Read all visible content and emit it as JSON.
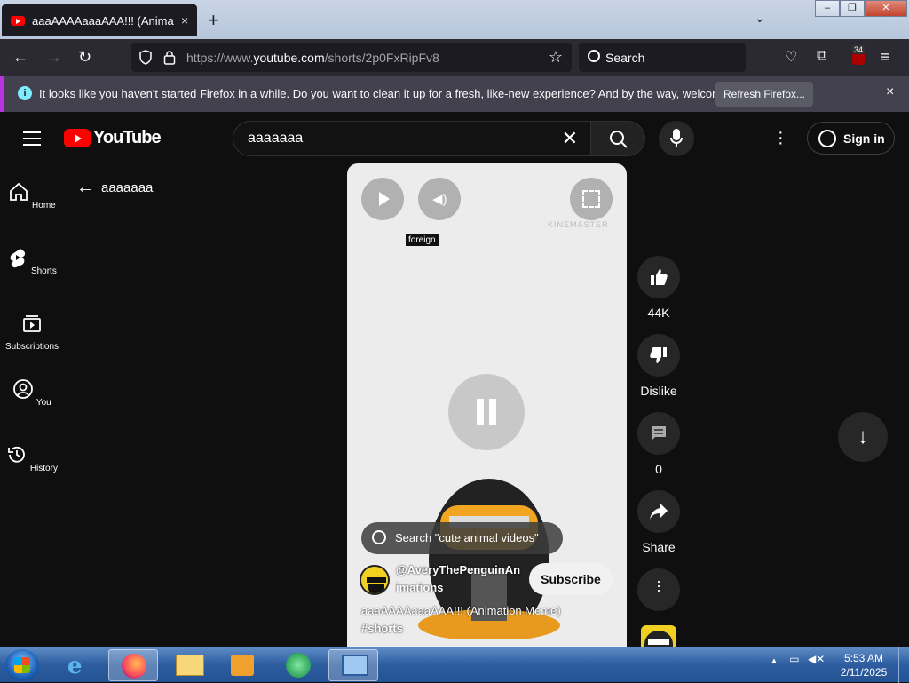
{
  "browser": {
    "tab_title": "aaaAAAAaaaAAA!!! (Animation",
    "tab_close": "×",
    "new_tab": "+",
    "tab_list": "⌄",
    "window_buttons": {
      "minimize": "–",
      "maximize": "❐",
      "close": "✕"
    },
    "url_prefix": "https://www.",
    "url_host": "youtube.com",
    "url_path": "/shorts/2p0FxRipFv8",
    "search_placeholder": "Search",
    "extensions_badge": "34",
    "notification": {
      "text": "It looks like you haven't started Firefox in a while. Do you want to clean it up for a fresh, like-new experience? And by the way, welcome back!",
      "button": "Refresh Firefox...",
      "close": "×"
    }
  },
  "youtube": {
    "logo_text": "YouTube",
    "search_value": "aaaaaaa",
    "search_clear": "✕",
    "sign_in": "Sign in",
    "sidebar": [
      {
        "label": "Home",
        "icon": "home-icon"
      },
      {
        "label": "Shorts",
        "icon": "shorts-icon"
      },
      {
        "label": "Subscriptions",
        "icon": "subscriptions-icon"
      },
      {
        "label": "You",
        "icon": "you-icon"
      },
      {
        "label": "History",
        "icon": "history-icon"
      }
    ],
    "back_query": "aaaaaaa",
    "video": {
      "tooltip": "foreign",
      "watermark": "KINEMASTER",
      "search_pill": "Search \"cute animal videos\"",
      "channel_line1": "@AveryThePenguinAn",
      "channel_line2": "imations",
      "subscribe": "Subscribe",
      "title": "aaaAAAAaaaAAA!!! (Animation Meme)",
      "hashtag": "#shorts"
    },
    "actions": {
      "likes": "44K",
      "dislike": "Dislike",
      "comments": "0",
      "share": "Share"
    }
  },
  "taskbar": {
    "time": "5:53 AM",
    "date": "2/11/2025",
    "tray_arrow": "▲"
  }
}
